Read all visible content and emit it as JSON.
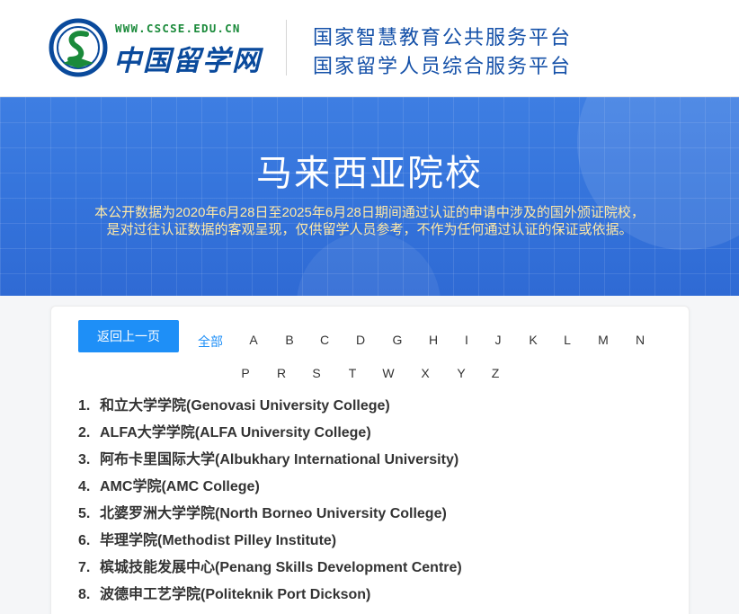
{
  "header": {
    "logo_url_text": "WWW.CSCSE.EDU.CN",
    "logo_name": "中国留学网",
    "platform_line1": "国家智慧教育公共服务平台",
    "platform_line2": "国家留学人员综合服务平台"
  },
  "banner": {
    "title": "马来西亚院校",
    "desc_line1": "本公开数据为2020年6月28日至2025年6月28日期间通过认证的申请中涉及的国外颁证院校，",
    "desc_line2": "是对过往认证数据的客观呈现，仅供留学人员参考，不作为任何通过认证的保证或依据。"
  },
  "toolbar": {
    "back_label": "返回上一页",
    "all_label": "全部",
    "letters_row1": [
      "A",
      "B",
      "C",
      "D",
      "G",
      "H",
      "I",
      "J",
      "K",
      "L",
      "M",
      "N"
    ],
    "letters_row2": [
      "P",
      "R",
      "S",
      "T",
      "W",
      "X",
      "Y",
      "Z"
    ]
  },
  "schools": [
    {
      "num": "1.",
      "name": "和立大学学院(Genovasi University College)"
    },
    {
      "num": "2.",
      "name": "ALFA大学学院(ALFA University College)"
    },
    {
      "num": "3.",
      "name": "阿布卡里国际大学(Albukhary International University)"
    },
    {
      "num": "4.",
      "name": "AMC学院(AMC College)"
    },
    {
      "num": "5.",
      "name": "北婆罗洲大学学院(North Borneo University College)"
    },
    {
      "num": "6.",
      "name": "毕理学院(Methodist Pilley Institute)"
    },
    {
      "num": "7.",
      "name": "槟城技能发展中心(Penang Skills Development Centre)"
    },
    {
      "num": "8.",
      "name": "波德申工艺学院(Politeknik Port Dickson)"
    }
  ],
  "colors": {
    "accent": "#1e8ff7",
    "banner": "#3473db",
    "desc_text": "#ffe9a6",
    "brand_blue": "#0a4a9c",
    "brand_green": "#1a8a3a"
  }
}
